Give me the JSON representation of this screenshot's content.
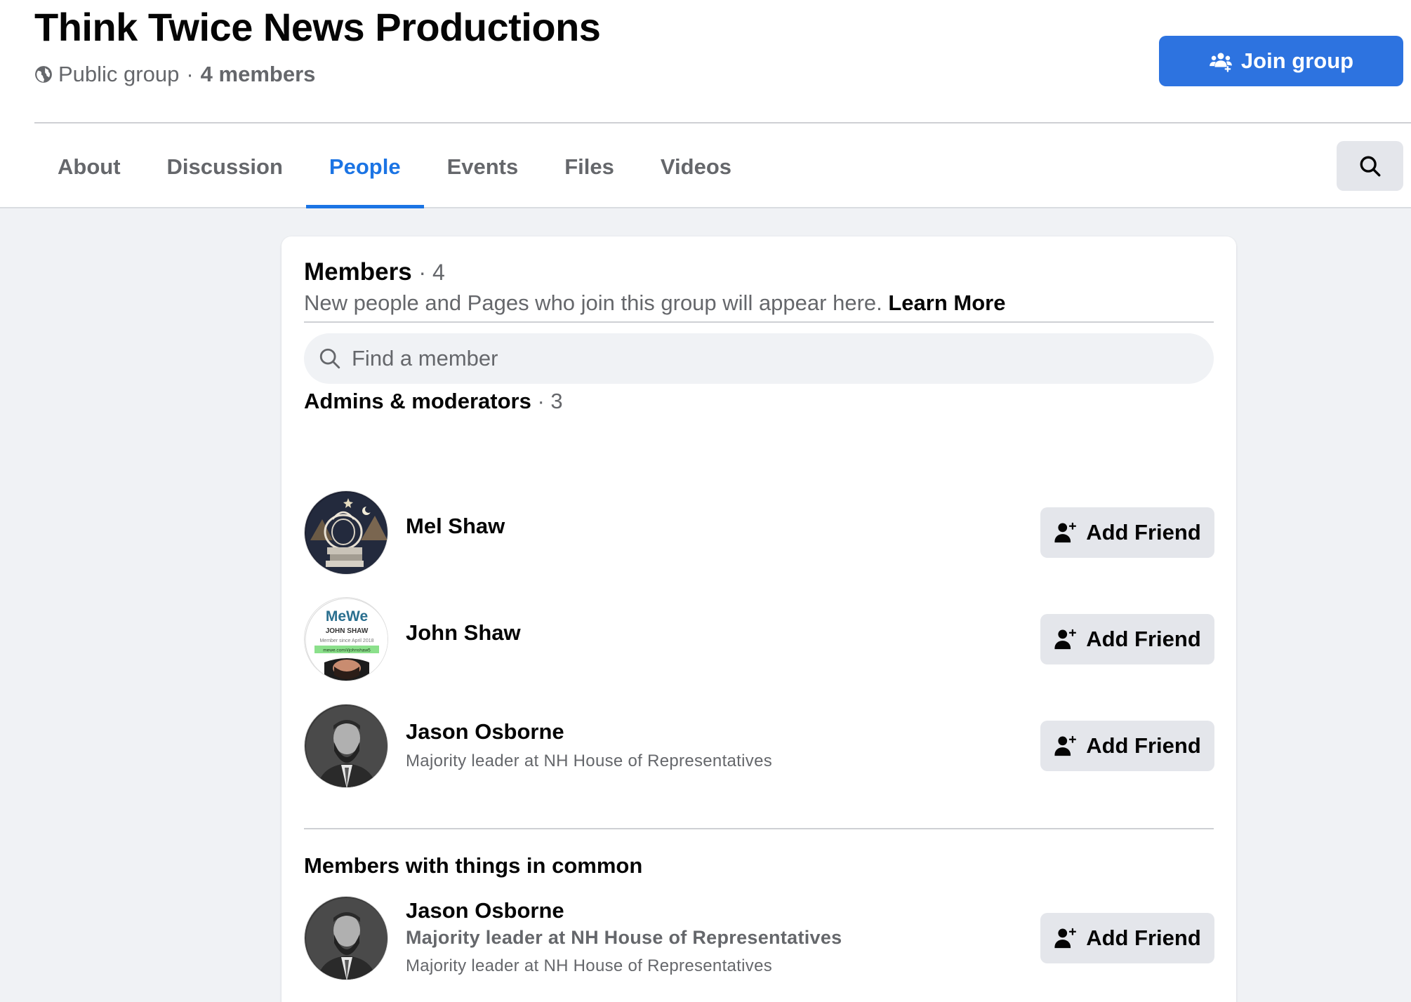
{
  "group": {
    "title": "Think Twice News Productions",
    "privacy": "Public group",
    "separator": "·",
    "members_count": "4 members",
    "join_label": "Join group"
  },
  "tabs": [
    {
      "label": "About"
    },
    {
      "label": "Discussion"
    },
    {
      "label": "People"
    },
    {
      "label": "Events"
    },
    {
      "label": "Files"
    },
    {
      "label": "Videos"
    }
  ],
  "active_tab": "People",
  "members_card": {
    "title": "Members",
    "count": "· 4",
    "subtitle": "New people and Pages who join this group will appear here.",
    "learn_more": "Learn More",
    "search_placeholder": "Find a member"
  },
  "admins": {
    "title": "Admins & moderators",
    "count": "· 3",
    "items": [
      {
        "name": "Mel Shaw",
        "subtitle": "",
        "button": "Add Friend"
      },
      {
        "name": "John Shaw",
        "subtitle": "",
        "button": "Add Friend",
        "avatar_text": [
          "MeWe",
          "JOHN SHAW",
          "Member since April 2018",
          "mewe.com/i/johnshaw5"
        ]
      },
      {
        "name": "Jason Osborne",
        "subtitle": "Majority leader at NH House of Representatives",
        "button": "Add Friend"
      }
    ]
  },
  "common": {
    "title": "Members with things in common",
    "items": [
      {
        "name": "Jason Osborne",
        "highlight": "Majority leader at NH House of Representatives",
        "subtitle": "Majority leader at NH House of Representatives",
        "button": "Add Friend"
      }
    ]
  },
  "colors": {
    "accent": "#1b74e4",
    "join_button": "#2d73e0",
    "secondary_button": "#e4e6eb",
    "page_background": "#f0f2f5"
  },
  "icons": [
    "globe-icon",
    "join-group-icon",
    "search-icon",
    "add-friend-icon"
  ]
}
